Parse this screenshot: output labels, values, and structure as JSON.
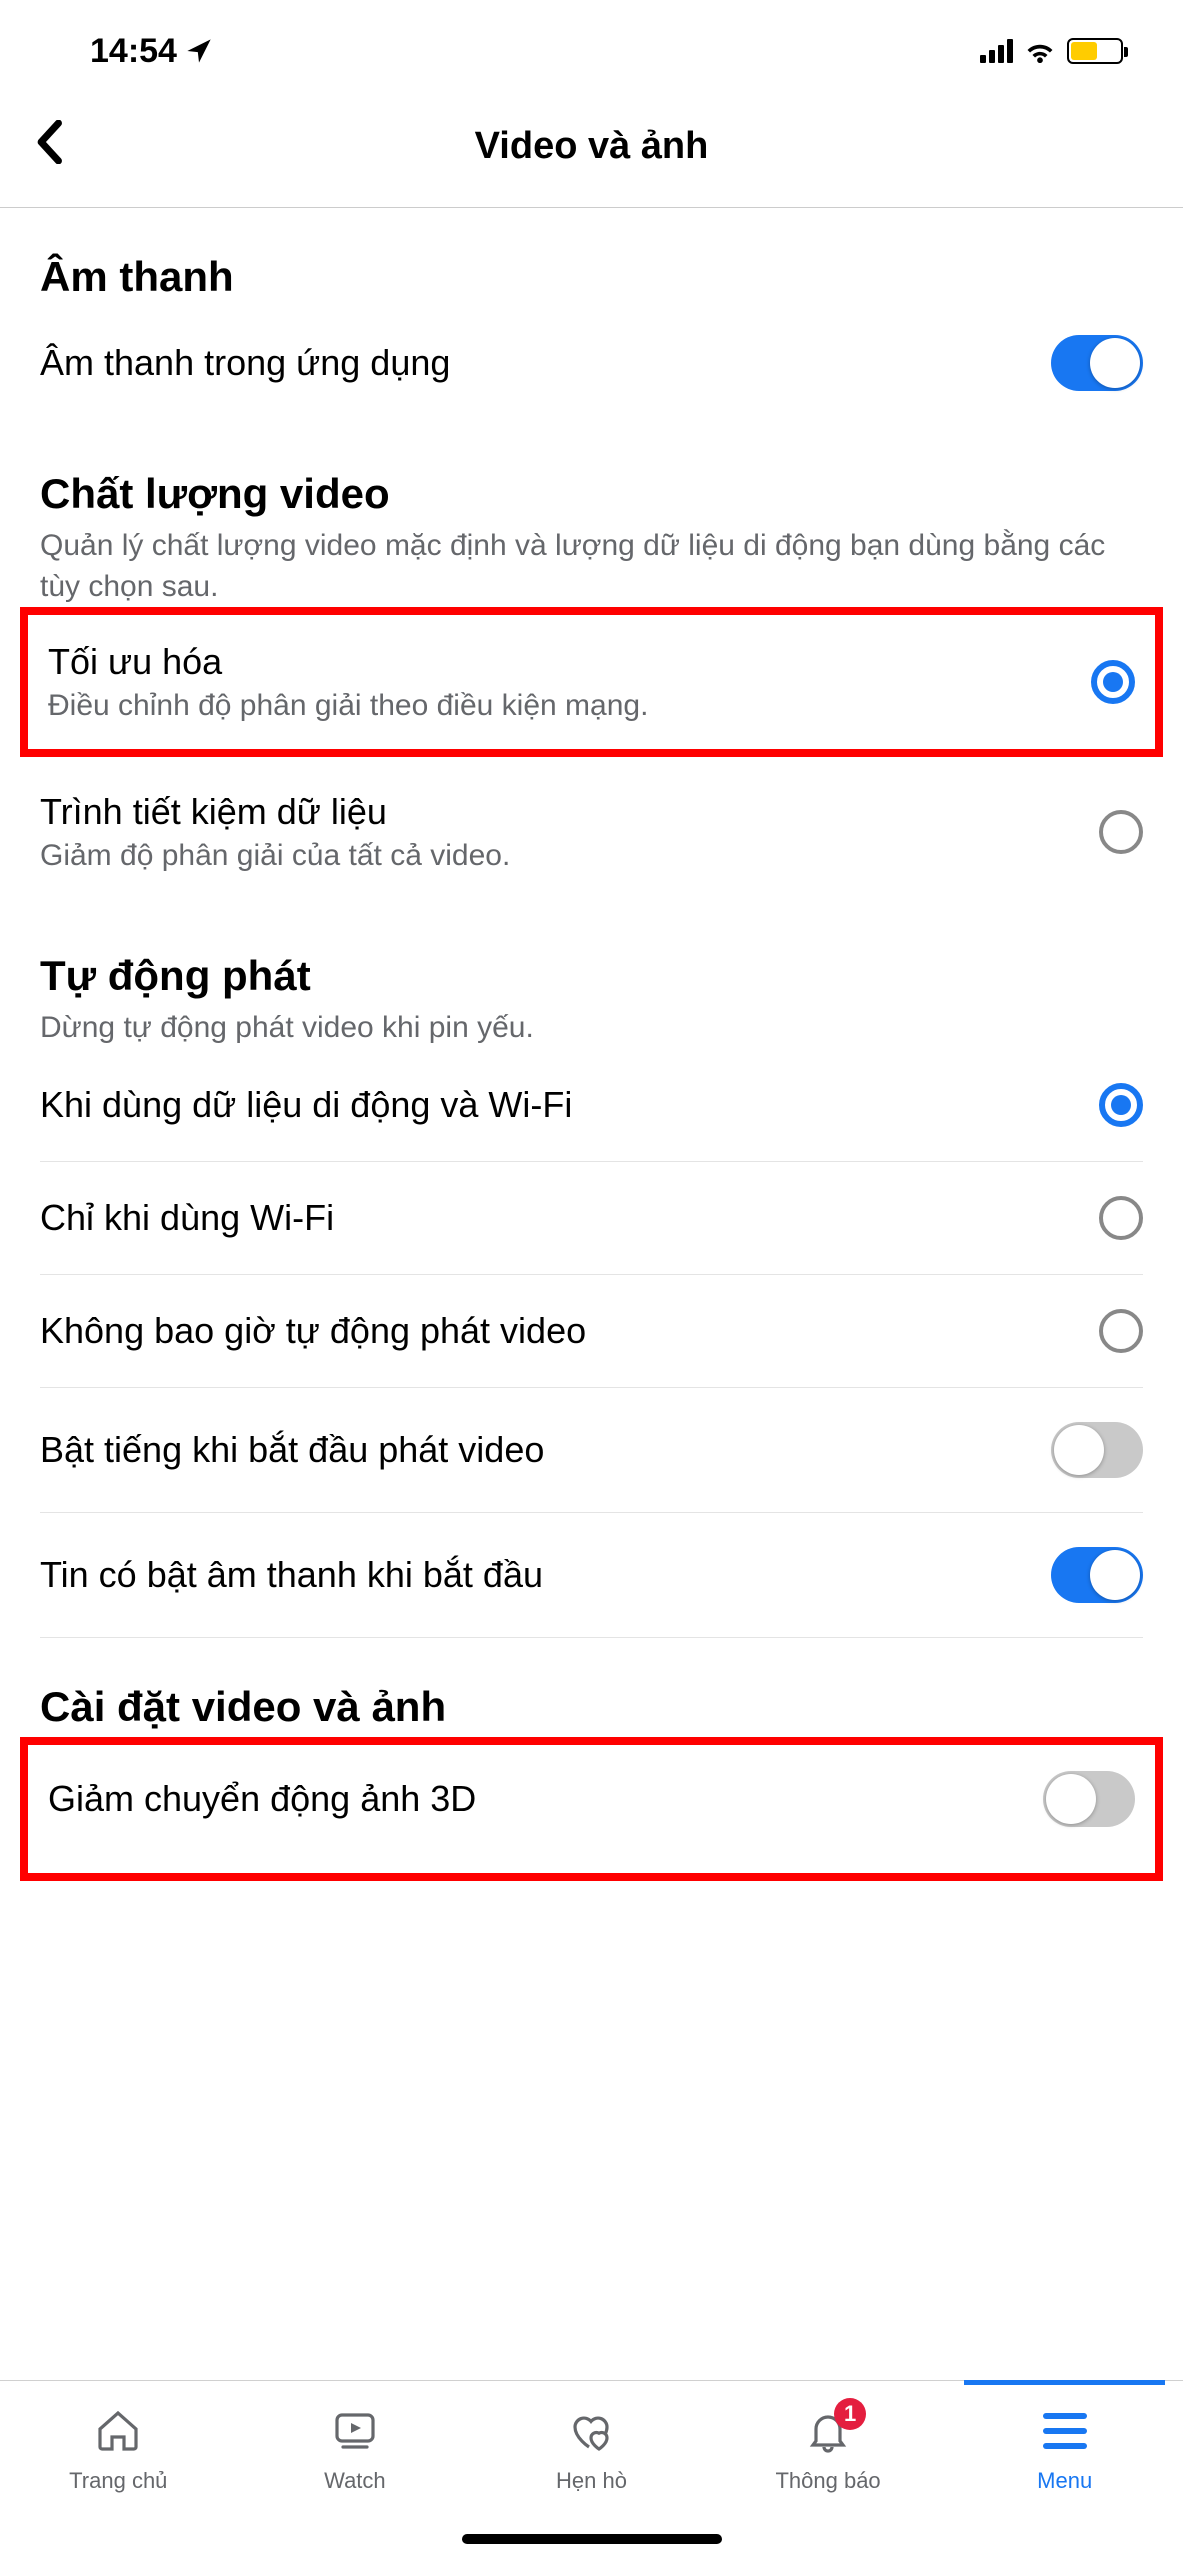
{
  "statusBar": {
    "time": "14:54"
  },
  "header": {
    "title": "Video và ảnh"
  },
  "sections": {
    "sound": {
      "title": "Âm thanh",
      "row0": {
        "title": "Âm thanh trong ứng dụng"
      }
    },
    "quality": {
      "title": "Chất lượng video",
      "desc": "Quản lý chất lượng video mặc định và lượng dữ liệu di động bạn dùng bằng các tùy chọn sau.",
      "opt0": {
        "title": "Tối ưu hóa",
        "desc": "Điều chỉnh độ phân giải theo điều kiện mạng."
      },
      "opt1": {
        "title": "Trình tiết kiệm dữ liệu",
        "desc": "Giảm độ phân giải của tất cả video."
      }
    },
    "autoplay": {
      "title": "Tự động phát",
      "desc": "Dừng tự động phát video khi pin yếu.",
      "opt0": {
        "title": "Khi dùng dữ liệu di động và Wi-Fi"
      },
      "opt1": {
        "title": "Chỉ khi dùng Wi-Fi"
      },
      "opt2": {
        "title": "Không bao giờ tự động phát video"
      },
      "tog0": {
        "title": "Bật tiếng khi bắt đầu phát video"
      },
      "tog1": {
        "title": "Tin có bật âm thanh khi bắt đầu"
      }
    },
    "settings": {
      "title": "Cài đặt video và ảnh",
      "row0": {
        "title": "Giảm chuyển động ảnh 3D"
      }
    }
  },
  "tabs": {
    "t0": "Trang chủ",
    "t1": "Watch",
    "t2": "Hẹn hò",
    "t3": "Thông báo",
    "t4": "Menu",
    "badge": "1"
  }
}
